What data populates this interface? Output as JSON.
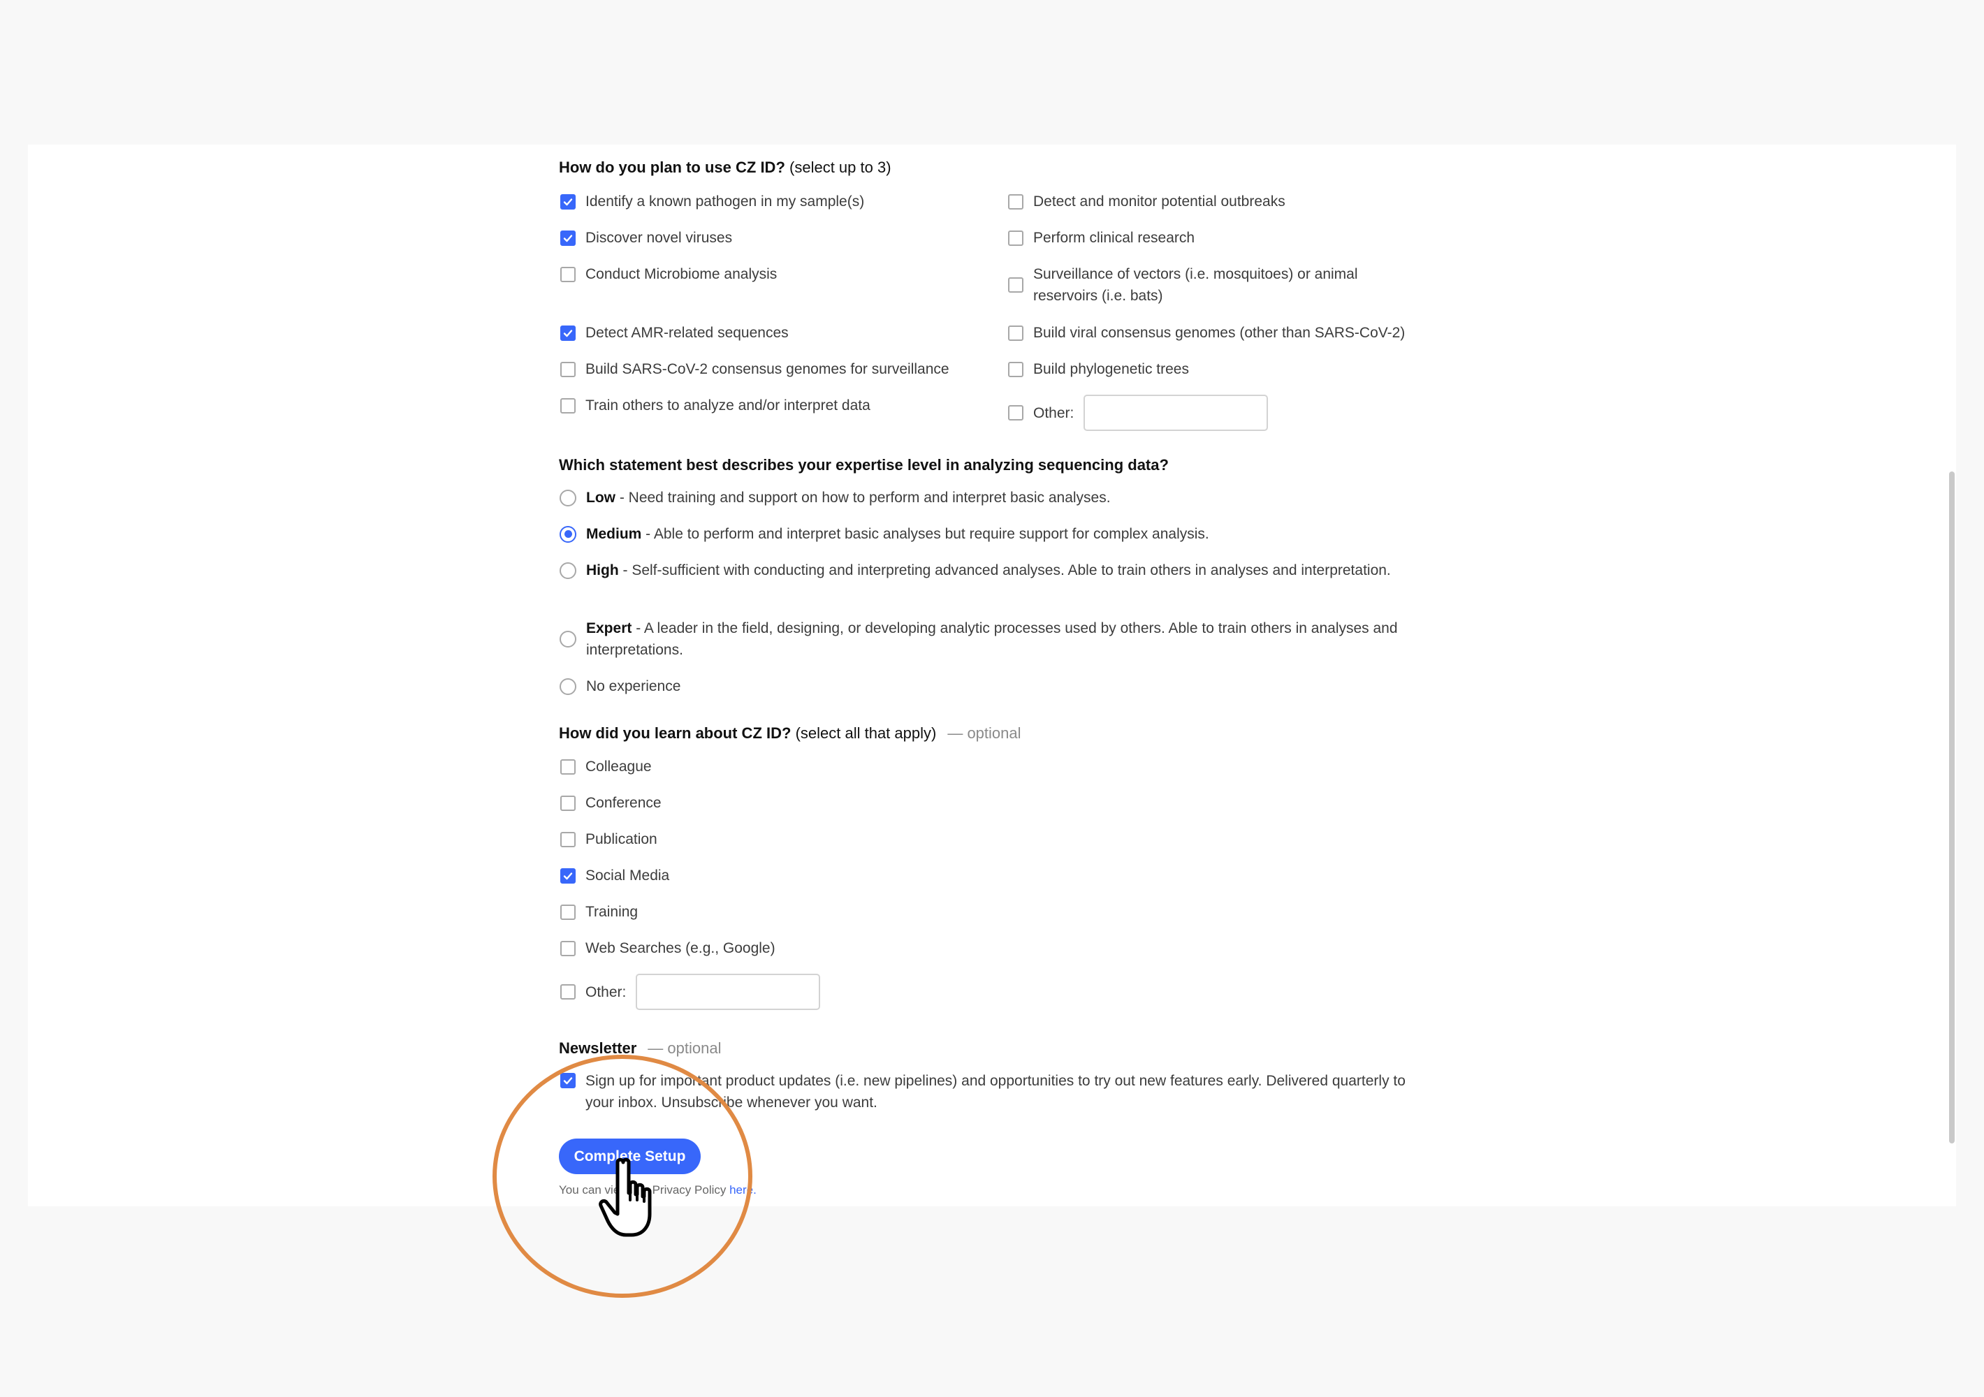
{
  "use_question": {
    "heading_bold": "How do you plan to use CZ ID?",
    "heading_note": " (select up to 3)",
    "options": [
      {
        "label": "Identify a known pathogen in my sample(s)",
        "checked": true
      },
      {
        "label": "Detect and monitor potential outbreaks",
        "checked": false
      },
      {
        "label": "Discover novel viruses",
        "checked": true
      },
      {
        "label": "Perform clinical research",
        "checked": false
      },
      {
        "label": "Conduct Microbiome analysis",
        "checked": false
      },
      {
        "label": "Surveillance of vectors (i.e. mosquitoes) or animal reservoirs (i.e. bats)",
        "checked": false
      },
      {
        "label": "Detect AMR-related sequences",
        "checked": true
      },
      {
        "label": "Build viral consensus genomes (other than SARS-CoV-2)",
        "checked": false
      },
      {
        "label": "Build SARS-CoV-2 consensus genomes for surveillance",
        "checked": false
      },
      {
        "label": "Build phylogenetic trees",
        "checked": false
      },
      {
        "label": "Train others to analyze and/or interpret data",
        "checked": false
      },
      {
        "label": "Other:",
        "checked": false
      }
    ],
    "other_value": ""
  },
  "expertise_question": {
    "heading": "Which statement best describes your expertise level in analyzing sequencing data?",
    "options": [
      {
        "level": "Low",
        "desc": " - Need training and support on how to perform and interpret basic analyses.",
        "selected": false
      },
      {
        "level": "Medium",
        "desc": " - Able to perform and interpret basic analyses but require support for complex analysis.",
        "selected": true
      },
      {
        "level": "High",
        "desc": " - Self-sufficient with conducting and interpreting advanced analyses. Able to train others in analyses and interpretation.",
        "selected": false
      },
      {
        "level": "Expert",
        "desc": " - A leader in the field, designing, or developing analytic processes used by others. Able to train others in analyses and interpretations.",
        "selected": false
      },
      {
        "level": "",
        "desc": "No experience",
        "selected": false
      }
    ]
  },
  "learn_question": {
    "heading_bold": "How did you learn about CZ ID?",
    "heading_note": " (select all that apply)",
    "optional": "— optional",
    "options": [
      {
        "label": "Colleague",
        "checked": false
      },
      {
        "label": "Conference",
        "checked": false
      },
      {
        "label": "Publication",
        "checked": false
      },
      {
        "label": "Social Media",
        "checked": true
      },
      {
        "label": "Training",
        "checked": false
      },
      {
        "label": "Web Searches (e.g., Google)",
        "checked": false
      },
      {
        "label": "Other:",
        "checked": false
      }
    ],
    "other_value": ""
  },
  "newsletter": {
    "heading": "Newsletter",
    "optional": "— optional",
    "checked": true,
    "label": "Sign up for important product updates (i.e. new pipelines) and opportunities to try out new features early. Delivered quarterly to your inbox. Unsubscribe whenever you want."
  },
  "submit": {
    "label": "Complete Setup"
  },
  "privacy": {
    "text": "You can view our Privacy Policy ",
    "link": "here."
  },
  "colors": {
    "accent": "#3867fa",
    "highlight": "#e08a44"
  }
}
